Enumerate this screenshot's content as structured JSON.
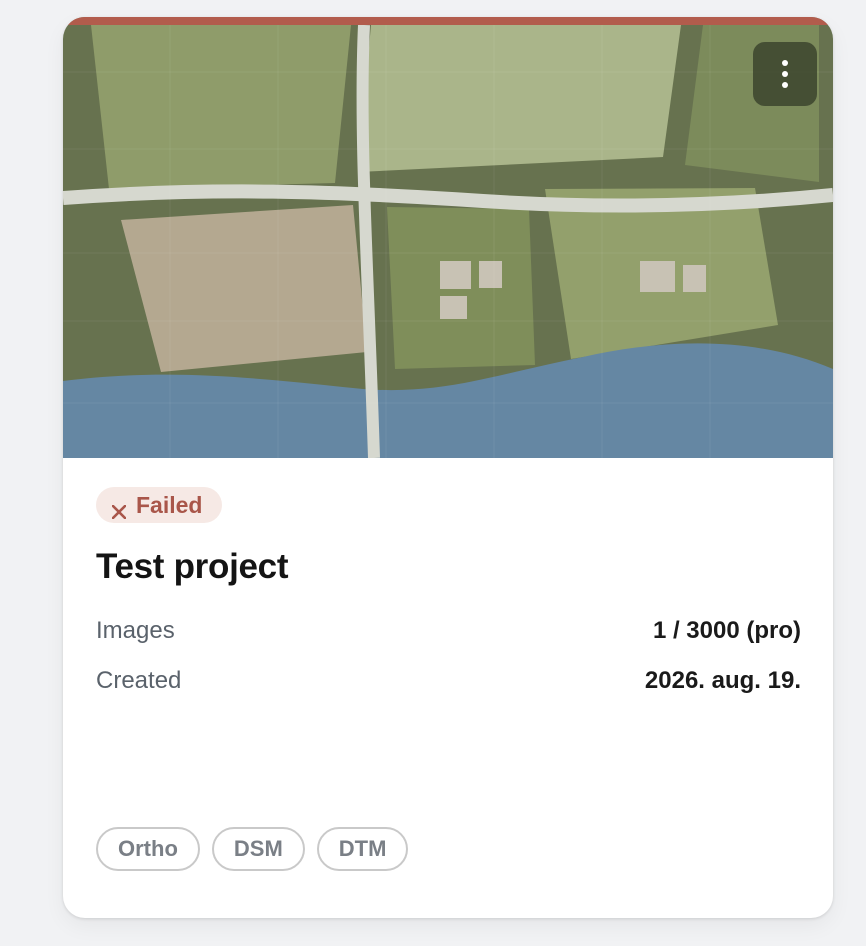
{
  "project_card": {
    "status": {
      "label": "Failed",
      "icon": "x-icon",
      "color": "#a9564a",
      "stripe_color": "#b25c4c"
    },
    "title": "Test project",
    "meta": [
      {
        "label": "Images",
        "value": "1 / 3000 (pro)"
      },
      {
        "label": "Created",
        "value": "2026. aug. 19."
      }
    ],
    "tags": [
      "Ortho",
      "DSM",
      "DTM"
    ],
    "menu_icon": "more-vertical-icon"
  }
}
